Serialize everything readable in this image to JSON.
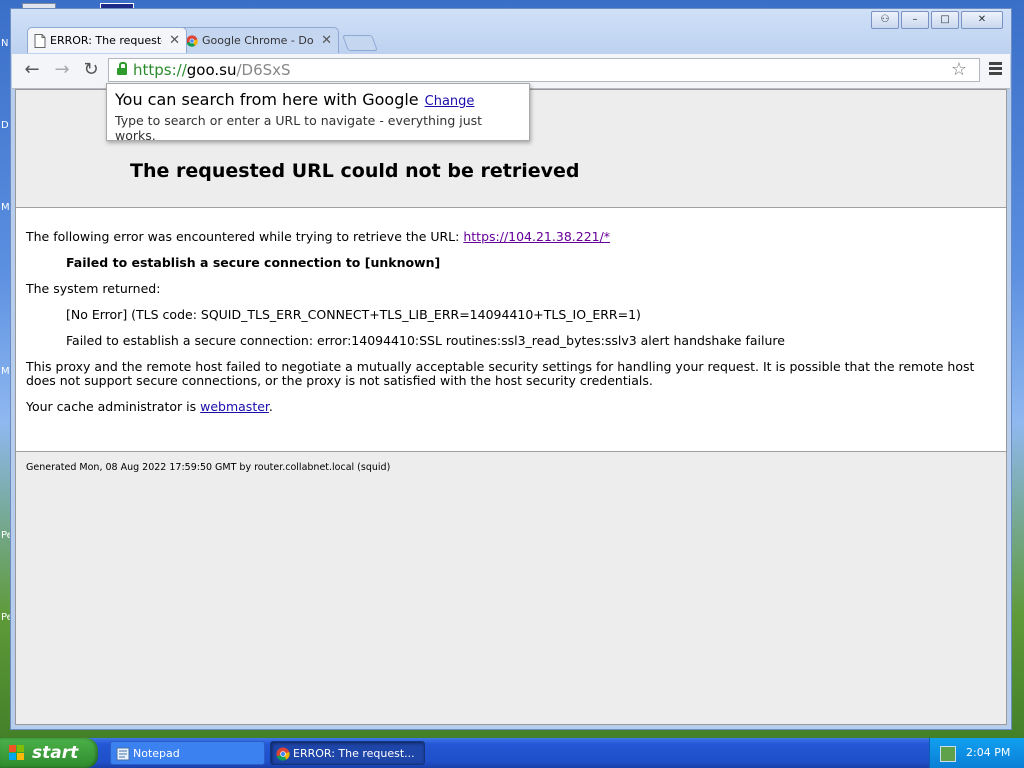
{
  "window": {
    "controls": {
      "user": "⚇",
      "minimize": "–",
      "maximize": "□",
      "close": "✕"
    }
  },
  "tabs": [
    {
      "title": "ERROR: The requested URL",
      "icon": "document-icon",
      "close": "✕",
      "active": true
    },
    {
      "title": "Google Chrome - Download t",
      "icon": "chrome-icon",
      "close": "✕",
      "active": false
    }
  ],
  "toolbar": {
    "back": "←",
    "forward": "→",
    "reload": "↻",
    "url_scheme": "https://",
    "url_host": "goo.su",
    "url_path": "/D6SxS",
    "bookmark": "☆"
  },
  "bubble": {
    "title": "You can search from here with Google",
    "link": "Change",
    "subtitle": "Type to search or enter a URL to navigate - everything just works."
  },
  "page": {
    "title": "The requested URL could not be retrieved",
    "intro": "The following error was encountered while trying to retrieve the URL: ",
    "error_url": "https://104.21.38.221/*",
    "error_heading": "Failed to establish a secure connection to [unknown]",
    "system_returned": "The system returned:",
    "no_error": "[No Error] (TLS code: SQUID_TLS_ERR_CONNECT+TLS_LIB_ERR=14094410+TLS_IO_ERR=1)",
    "ssl_error": "Failed to establish a secure connection: error:14094410:SSL routines:ssl3_read_bytes:sslv3 alert handshake failure",
    "explanation": "This proxy and the remote host failed to negotiate a mutually acceptable security settings for handling your request. It is possible that the remote host does not support secure connections, or the proxy is not satisfied with the host security credentials.",
    "admin_prefix": "Your cache administrator is ",
    "admin_link": "webmaster",
    "admin_suffix": ".",
    "footer": "Generated Mon, 08 Aug 2022 17:59:50 GMT by router.collabnet.local (squid)"
  },
  "taskbar": {
    "start": "start",
    "tasks": [
      {
        "label": "Notepad",
        "icon": "notepad-icon"
      },
      {
        "label": "ERROR: The request...",
        "icon": "chrome-icon"
      }
    ],
    "clock": "2:04 PM"
  },
  "desktop": {
    "fragments": [
      "N",
      "D",
      "M",
      "M",
      "Pe",
      "Pe"
    ]
  },
  "colors": {
    "taskbar": "#2457d6",
    "start_button": "#3a9a38",
    "secure_green": "#2d8b2d",
    "link": "#1a0dab"
  }
}
